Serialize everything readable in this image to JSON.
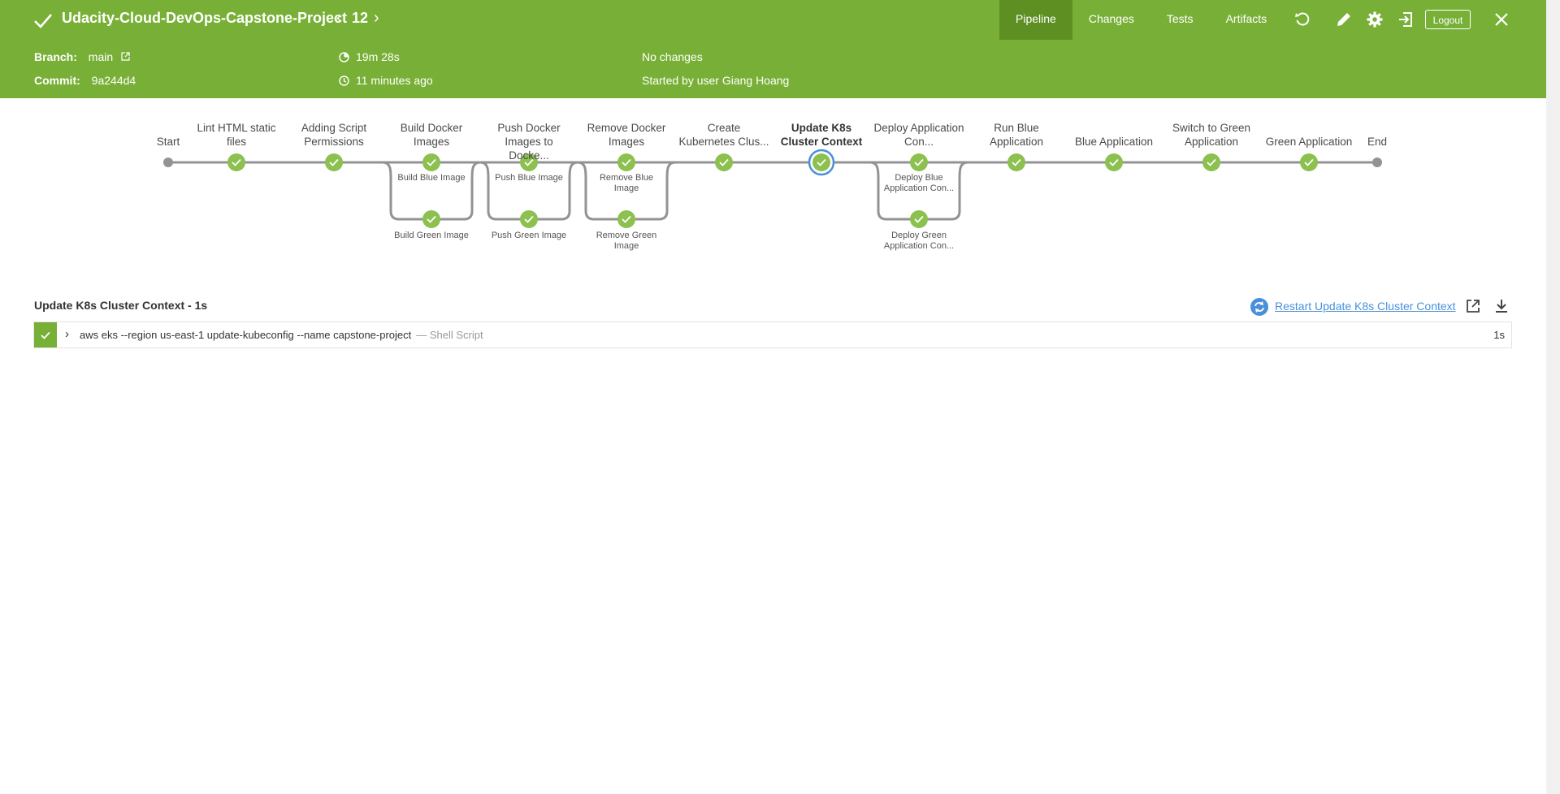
{
  "header": {
    "title": "Udacity-Cloud-DevOps-Capstone-Project",
    "run_number": "12",
    "prev_glyph": "‹",
    "next_glyph": "›",
    "status_icon": "check-icon",
    "tabs": [
      {
        "label": "Pipeline",
        "active": true
      },
      {
        "label": "Changes",
        "active": false
      },
      {
        "label": "Tests",
        "active": false
      },
      {
        "label": "Artifacts",
        "active": false
      }
    ],
    "tools": [
      "replay-icon",
      "edit-icon",
      "gear-icon",
      "exit-icon"
    ],
    "logout_label": "Logout",
    "close_icon": "close-icon"
  },
  "meta": {
    "branch_label": "Branch:",
    "branch_value": "main",
    "commit_label": "Commit:",
    "commit_value": "9a244d4",
    "duration": "19m 28s",
    "started_ago": "11 minutes ago",
    "changes": "No changes",
    "started_by": "Started by user Giang Hoang"
  },
  "pipeline": {
    "start_label": "Start",
    "end_label": "End",
    "stages": [
      {
        "label": "Lint HTML static files"
      },
      {
        "label": "Adding Script Permissions"
      },
      {
        "label": "Build Docker Images",
        "branches": [
          "Build Blue Image",
          "Build Green Image"
        ]
      },
      {
        "label": "Push Docker Images to Docke...",
        "branches": [
          "Push Blue Image",
          "Push Green Image"
        ]
      },
      {
        "label": "Remove Docker Images",
        "branches": [
          "Remove Blue Image",
          "Remove Green Image"
        ]
      },
      {
        "label": "Create Kubernetes Clus..."
      },
      {
        "label": "Update K8s Cluster Context",
        "selected": true
      },
      {
        "label": "Deploy Application Con...",
        "branches": [
          "Deploy Blue Application Con...",
          "Deploy Green Application Con..."
        ]
      },
      {
        "label": "Run Blue Application"
      },
      {
        "label": "Blue Application"
      },
      {
        "label": "Switch to Green Application"
      },
      {
        "label": "Green Application"
      }
    ],
    "colors": {
      "success": "#8cc04f",
      "line": "#949393",
      "selected_ring": "#4a90d9"
    }
  },
  "step_panel": {
    "title": "Update K8s Cluster Context - 1s",
    "restart_label": "Restart Update K8s Cluster Context",
    "steps": [
      {
        "command": "aws eks --region us-east-1 update-kubeconfig --name capstone-project",
        "type": "— Shell Script",
        "duration": "1s"
      }
    ]
  }
}
